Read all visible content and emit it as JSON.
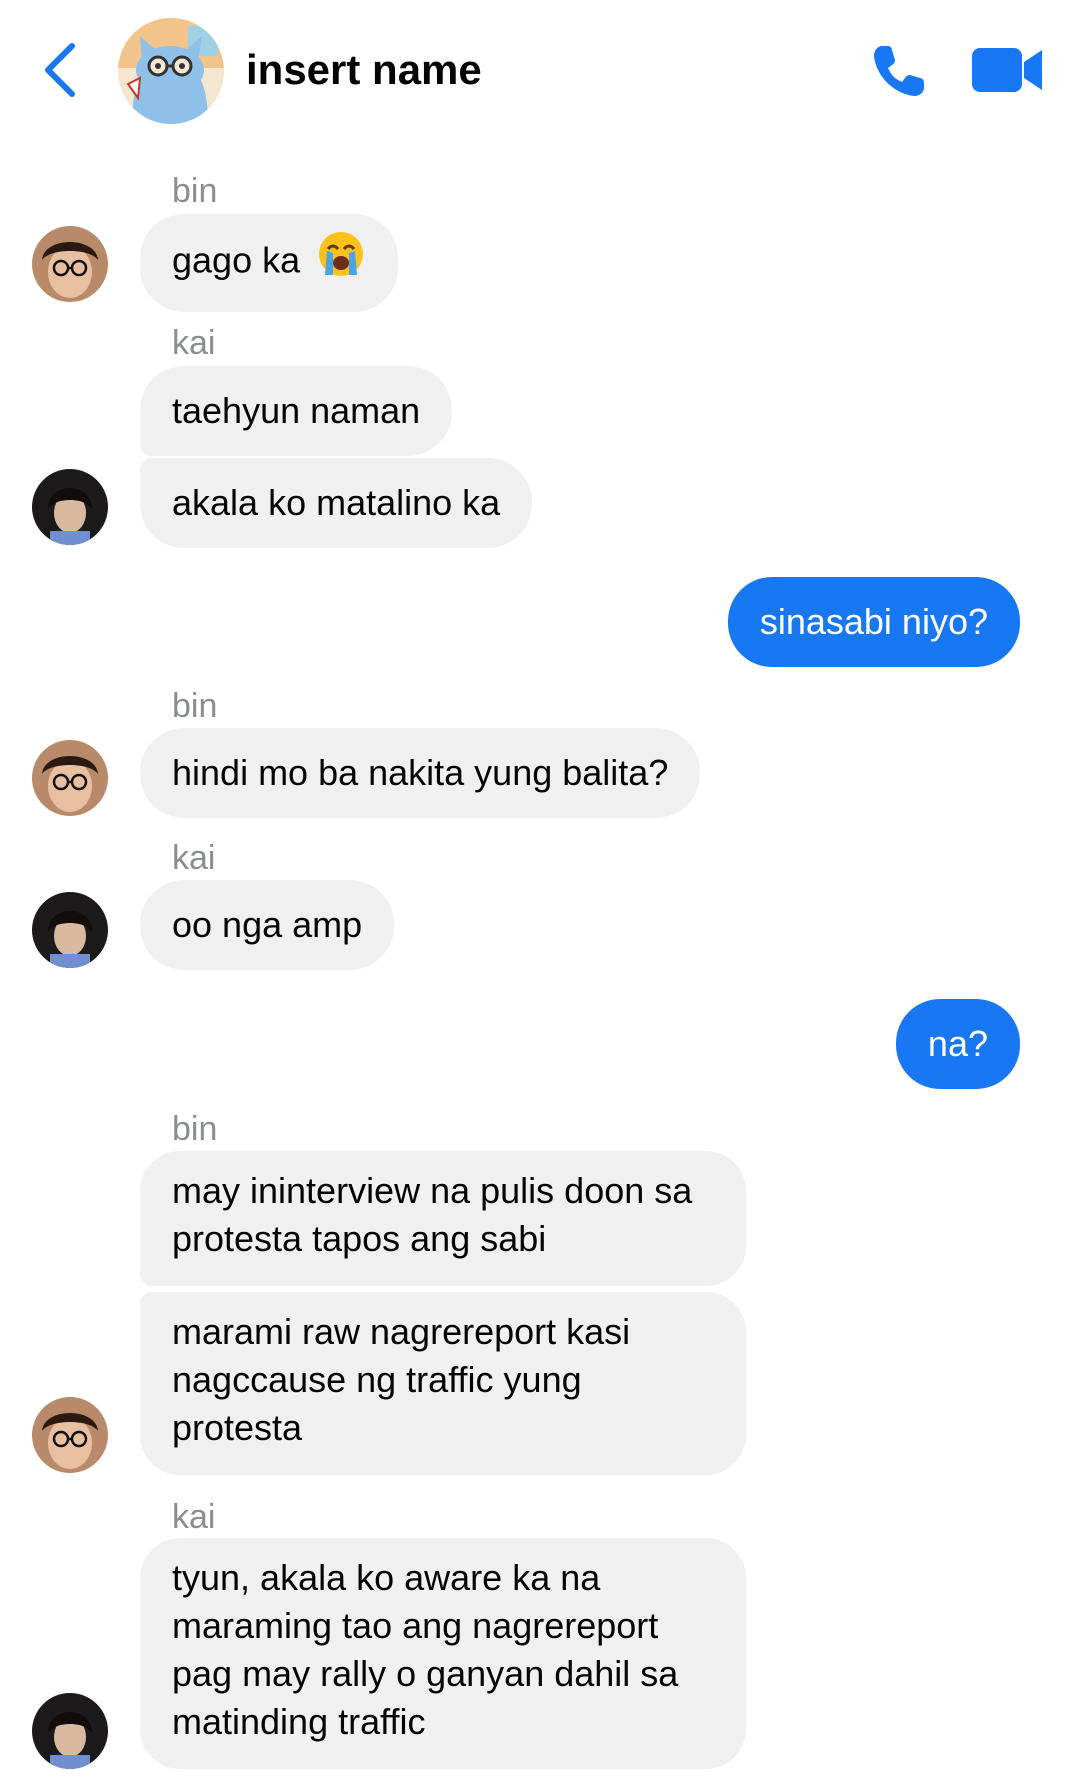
{
  "header": {
    "back_icon": "chevron-left-icon",
    "contact_name": "insert name",
    "avatar_icon": "blue-cat-sticker-avatar",
    "call_icon": "phone-icon",
    "video_icon": "video-camera-icon"
  },
  "colors": {
    "accent": "#1877f2",
    "incoming_bubble": "#f0f0f0",
    "sender_label": "#8a8d91"
  },
  "messages": [
    {
      "sender": "bin",
      "text": "gago ka",
      "emoji": "loudly-crying-face-emoji"
    },
    {
      "sender": "kai",
      "text": "taehyun naman"
    },
    {
      "sender": "kai",
      "text": "akala ko matalino ka"
    },
    {
      "sender": "me",
      "text": "sinasabi niyo?"
    },
    {
      "sender": "bin",
      "text": "hindi mo ba nakita yung balita?"
    },
    {
      "sender": "kai",
      "text": "oo nga amp"
    },
    {
      "sender": "me",
      "text": "na?"
    },
    {
      "sender": "bin",
      "text": "may ininterview na pulis doon sa protesta tapos ang sabi"
    },
    {
      "sender": "bin",
      "text": "marami raw nagrereport kasi nagccause ng traffic yung protesta"
    },
    {
      "sender": "kai",
      "text": "tyun, akala ko aware ka na maraming tao ang nagrereport pag may rally o ganyan dahil sa matinding traffic"
    }
  ]
}
